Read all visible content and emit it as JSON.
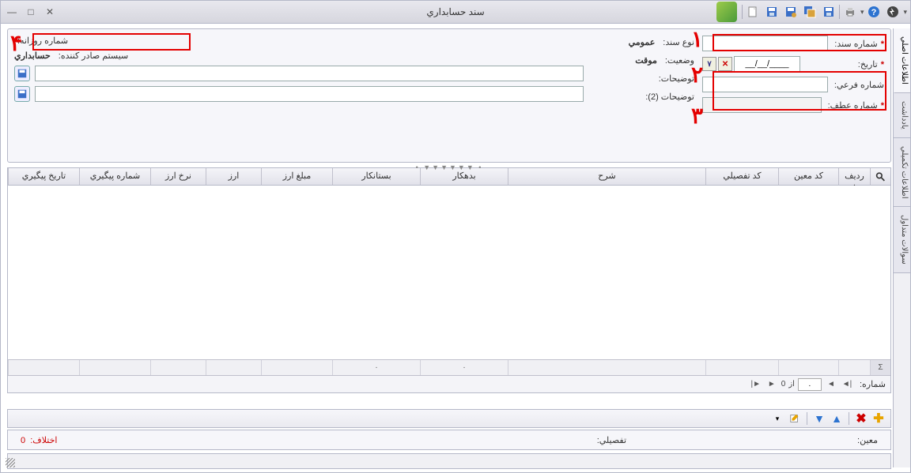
{
  "window": {
    "title": "سند حسابداري"
  },
  "form": {
    "doc_no_label": "شماره سند:",
    "date_label": "تاريخ:",
    "date_value": "____/__/__",
    "sub_no_label": "شماره فرعي:",
    "atf_no_label": "شماره عطف:",
    "type_label": "نوع سند:",
    "type_value": "عمومي",
    "status_label": "وضعيت:",
    "status_value": "موقت",
    "desc_label": "توضيحات:",
    "desc2_label": "توضيحات (2):",
    "daily_no_label": "شماره روزانه:",
    "issuer_label": "سيستم صادر کننده:",
    "issuer_value": "حسابداري"
  },
  "grid_headers": {
    "row": "رديف",
    "moin": "کد معين",
    "taf": "کد تفصيلي",
    "sharh": "شرح",
    "bedehkar": "بدهکار",
    "bestankar": "بستانکار",
    "mablagh_arz": "مبلغ ارز",
    "arz": "ارز",
    "nerkh": "نرخ ارز",
    "sh_peygiri": "شماره پيگيري",
    "t_peygiri": "تاريخ پيگيري",
    "sort_hint": "▲"
  },
  "sum": {
    "zero": "."
  },
  "nav": {
    "shomare": "شماره:",
    "az": "از",
    "total": "0",
    "cur": "."
  },
  "info": {
    "moin": "معين:",
    "tafsili": "تفصيلي:",
    "ekhtelaf_label": "اختلاف:",
    "ekhtelaf_val": "0"
  },
  "tabs": {
    "t1": "اطلاعات اصلي",
    "t2": "يادداشت",
    "t3": "اطلاعات تکميلي",
    "t4": "سوالات متداول"
  },
  "anno": {
    "n1": "۱",
    "n2": "۲",
    "n3": "۳",
    "n4": "۴"
  }
}
